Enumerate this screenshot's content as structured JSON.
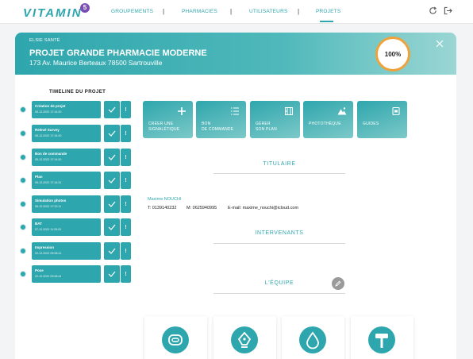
{
  "nav": {
    "logo": "VITAMIN",
    "logo_badge": "5",
    "items": [
      {
        "label": "GROUPEMENTS"
      },
      {
        "label": "PHARMACIES"
      },
      {
        "label": "UTILISATEURS"
      },
      {
        "label": "PROJETS"
      }
    ],
    "separator": "|",
    "active": "PROJETS"
  },
  "header": {
    "client": "ELSIE SANTÉ",
    "title": "PROJET GRANDE PHARMACIE MODERNE",
    "address": "173 Av. Maurice Berteaux 78500 Sartrouville",
    "progress": "100%",
    "progress_value": 1.0
  },
  "timeline": {
    "title": "TIMELINE DU PROJET",
    "steps": [
      {
        "label": "Création de projet",
        "date": "05-12-2022 17:14:20"
      },
      {
        "label": "Relevé Survey",
        "date": "05-12-2022 17:14:20"
      },
      {
        "label": "Bon de commande",
        "date": "05-12-2022 17:14:30"
      },
      {
        "label": "Plan",
        "date": "05-12-2022 17:14:31"
      },
      {
        "label": "Simulation photos",
        "date": "06-12-2022 17:22:11"
      },
      {
        "label": "BAT",
        "date": "07-12-2022 11:25:03"
      },
      {
        "label": "Impression",
        "date": "22-12-2022 09:08:41"
      },
      {
        "label": "Pose",
        "date": "22-12-2022 09:08:44"
      }
    ],
    "bang": "!"
  },
  "tiles": [
    {
      "line1": "CRÉER UNE",
      "line2": "SIGNALÉTIQUE",
      "icon": "plus-icon"
    },
    {
      "line1": "BON",
      "line2": "DE COMMANDE",
      "icon": "list-icon"
    },
    {
      "line1": "GÉRER",
      "line2": "SON PLAN",
      "icon": "plan-icon"
    },
    {
      "line1": "PHOTOTHÈQUE",
      "line2": "",
      "icon": "mountain-icon"
    },
    {
      "line1": "GUIDES",
      "line2": "",
      "icon": "guide-icon"
    }
  ],
  "titulaire": {
    "title": "TITULAIRE",
    "name": "Maxime NOUCHI",
    "tel": "T: 0139140232",
    "mobile": "M: 0625940995",
    "email": "E-mail: maxime_nouchi@icloud.com"
  },
  "intervenants": {
    "title": "INTERVENANTS"
  },
  "equipe": {
    "title": "L'ÉQUIPE"
  },
  "bottom_cards": [
    "tape-measure-icon",
    "pen-nib-icon",
    "ink-drop-icon",
    "paint-roller-icon"
  ],
  "colors": {
    "accent": "#2ea6ad",
    "progress": "#f0a23a",
    "badge": "#7a4cb5"
  }
}
